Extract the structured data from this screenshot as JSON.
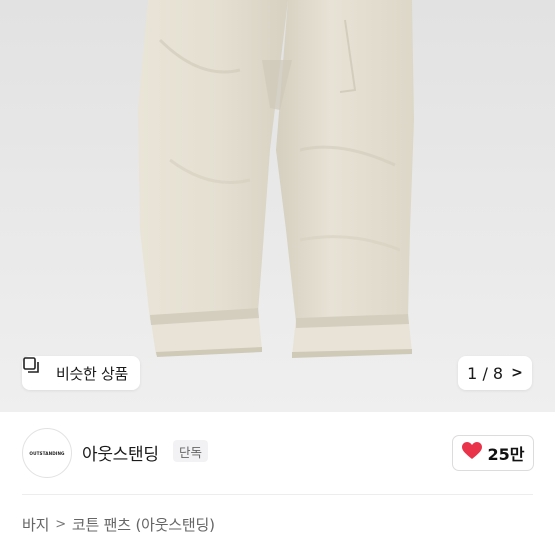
{
  "gallery": {
    "similar_label": "비슷한 상품",
    "pager_text": "1 / 8",
    "pager_chevron": ">",
    "image_subject": "cream cotton pants, rolled cuffs"
  },
  "seller": {
    "logo_text": "OUTSTANDING",
    "name": "아웃스탠딩",
    "badge": "단독",
    "like_count": "25만",
    "like_color": "#e8334a"
  },
  "breadcrumb": {
    "items": [
      "바지",
      "코튼 팬츠 (아웃스탠딩)"
    ],
    "separator": ">"
  },
  "colors": {
    "pants": "#e6e1d3",
    "pants_shadow": "#d3cdbd",
    "background": "#e8e8e8"
  }
}
